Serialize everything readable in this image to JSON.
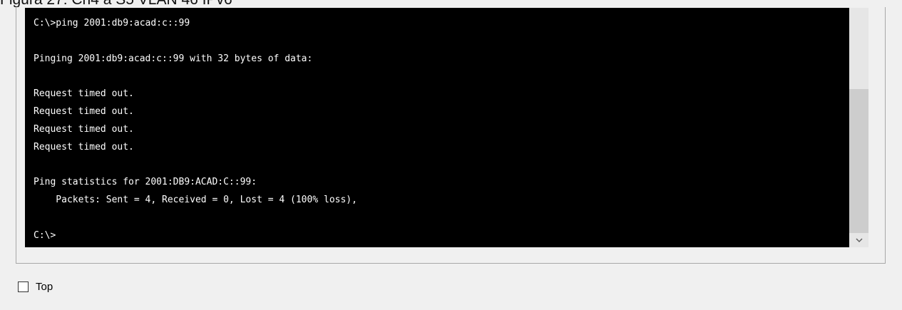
{
  "caption": {
    "text": "Figura 27: Ch4 a S5 VLAN 46 IPv6"
  },
  "terminal": {
    "lines": [
      "C:\\>ping 2001:db9:acad:c::99",
      "",
      "Pinging 2001:db9:acad:c::99 with 32 bytes of data:",
      "",
      "Request timed out.",
      "Request timed out.",
      "Request timed out.",
      "Request timed out.",
      "",
      "Ping statistics for 2001:DB9:ACAD:C::99:",
      "    Packets: Sent = 4, Received = 0, Lost = 4 (100% loss),",
      "",
      "C:\\>"
    ]
  },
  "scrollbar": {
    "down_icon": "chevron-down-icon"
  },
  "top_option": {
    "label": "Top",
    "checked": false
  },
  "colors": {
    "terminal_bg": "#000000",
    "terminal_fg": "#ffffff",
    "window_bg": "#f0f0f0"
  }
}
